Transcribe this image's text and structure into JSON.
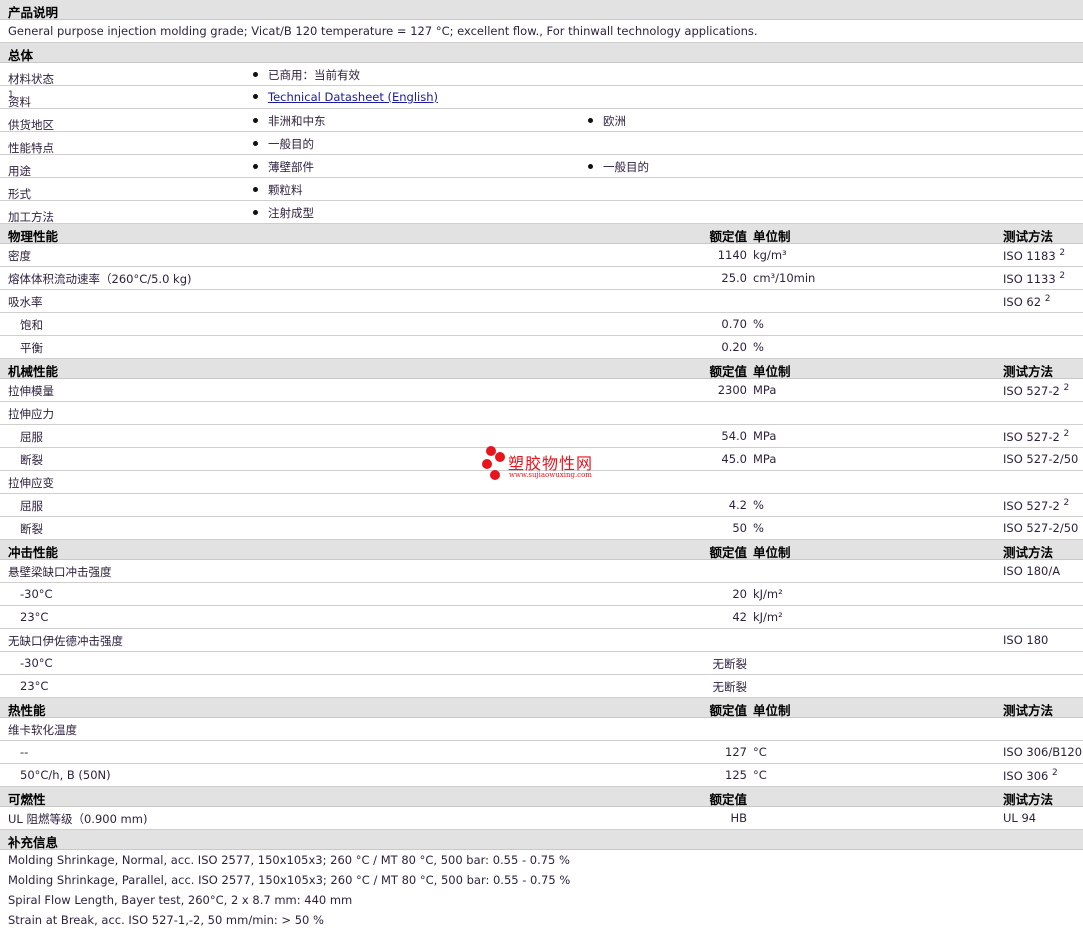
{
  "sections": [
    {
      "title": "产品说明",
      "type": "text",
      "rows": [
        {
          "text": "General purpose injection molding grade; Vicat/B 120 temperature = 127 °C; excellent flow., For thinwall technology applications."
        }
      ]
    },
    {
      "title": "总体",
      "type": "bullets",
      "rows": [
        {
          "label": "材料状态",
          "items": [
            "已商用：当前有效"
          ]
        },
        {
          "label": "资料",
          "sup": "1",
          "items": [
            "Technical Datasheet (English)"
          ],
          "link": true
        },
        {
          "label": "供货地区",
          "items": [
            "非洲和中东",
            "欧洲"
          ]
        },
        {
          "label": "性能特点",
          "items": [
            "一般目的"
          ]
        },
        {
          "label": "用途",
          "items": [
            "薄壁部件",
            "一般目的"
          ]
        },
        {
          "label": "形式",
          "items": [
            "颗粒料"
          ]
        },
        {
          "label": "加工方法",
          "items": [
            "注射成型"
          ]
        }
      ]
    },
    {
      "title": "物理性能",
      "type": "props",
      "col_value": "额定值",
      "col_unit": "单位制",
      "col_test": "测试方法",
      "rows": [
        {
          "label": "密度",
          "value": "1140",
          "unit": "kg/m³",
          "test": "ISO 1183",
          "sup": "2"
        },
        {
          "label": "熔体体积流动速率（260°C/5.0 kg)",
          "value": "25.0",
          "unit": "cm³/10min",
          "test": "ISO 1133",
          "sup": "2"
        },
        {
          "label": "吸水率",
          "test": "ISO 62",
          "sup": "2"
        },
        {
          "label": "饱和",
          "indent": true,
          "value": "0.70",
          "unit": "%"
        },
        {
          "label": "平衡",
          "indent": true,
          "value": "0.20",
          "unit": "%"
        }
      ]
    },
    {
      "title": "机械性能",
      "type": "props",
      "col_value": "额定值",
      "col_unit": "单位制",
      "col_test": "测试方法",
      "rows": [
        {
          "label": "拉伸模量",
          "value": "2300",
          "unit": "MPa",
          "test": "ISO 527-2",
          "sup": "2"
        },
        {
          "label": "拉伸应力"
        },
        {
          "label": "屈服",
          "indent": true,
          "value": "54.0",
          "unit": "MPa",
          "test": "ISO 527-2",
          "sup": "2"
        },
        {
          "label": "断裂",
          "indent": true,
          "value": "45.0",
          "unit": "MPa",
          "test": "ISO 527-2/50"
        },
        {
          "label": "拉伸应变"
        },
        {
          "label": "屈服",
          "indent": true,
          "value": "4.2",
          "unit": "%",
          "test": "ISO 527-2",
          "sup": "2"
        },
        {
          "label": "断裂",
          "indent": true,
          "value": "50",
          "unit": "%",
          "test": "ISO 527-2/50"
        }
      ]
    },
    {
      "title": "冲击性能",
      "type": "props",
      "col_value": "额定值",
      "col_unit": "单位制",
      "col_test": "测试方法",
      "rows": [
        {
          "label": "悬壁梁缺口冲击强度",
          "test": "ISO 180/A"
        },
        {
          "label": "-30°C",
          "indent": true,
          "value": "20",
          "unit": "kJ/m²"
        },
        {
          "label": "23°C",
          "indent": true,
          "value": "42",
          "unit": "kJ/m²"
        },
        {
          "label": "无缺口伊佐德冲击强度",
          "test": "ISO 180"
        },
        {
          "label": "-30°C",
          "indent": true,
          "value": "无断裂"
        },
        {
          "label": "23°C",
          "indent": true,
          "value": "无断裂"
        }
      ]
    },
    {
      "title": "热性能",
      "type": "props",
      "col_value": "额定值",
      "col_unit": "单位制",
      "col_test": "测试方法",
      "rows": [
        {
          "label": "维卡软化温度"
        },
        {
          "label": "--",
          "indent": true,
          "value": "127",
          "unit": "°C",
          "test": "ISO 306/B120"
        },
        {
          "label": "50°C/h, B (50N)",
          "indent": true,
          "value": "125",
          "unit": "°C",
          "test": "ISO 306",
          "sup": "2"
        }
      ]
    },
    {
      "title": "可燃性",
      "type": "props",
      "col_value": "额定值",
      "col_test": "测试方法",
      "rows": [
        {
          "label": "UL 阻燃等级（0.900 mm)",
          "value": "HB",
          "test": "UL 94"
        }
      ]
    },
    {
      "title": "补充信息",
      "type": "notes",
      "rows": [
        {
          "text": "Molding Shrinkage, Normal, acc. ISO 2577, 150x105x3; 260 °C / MT 80 °C, 500 bar: 0.55 - 0.75 %"
        },
        {
          "text": "Molding Shrinkage, Parallel, acc. ISO 2577, 150x105x3; 260 °C / MT 80 °C, 500 bar: 0.55 - 0.75 %"
        },
        {
          "text": "Spiral Flow Length, Bayer test, 260°C, 2 x 8.7 mm: 440 mm"
        },
        {
          "text": "Strain at Break, acc. ISO 527-1,-2, 50 mm/min: > 50 %"
        }
      ]
    }
  ],
  "watermark": {
    "name": "塑胶物性网",
    "url": "www.sujiaowuxing.com"
  }
}
